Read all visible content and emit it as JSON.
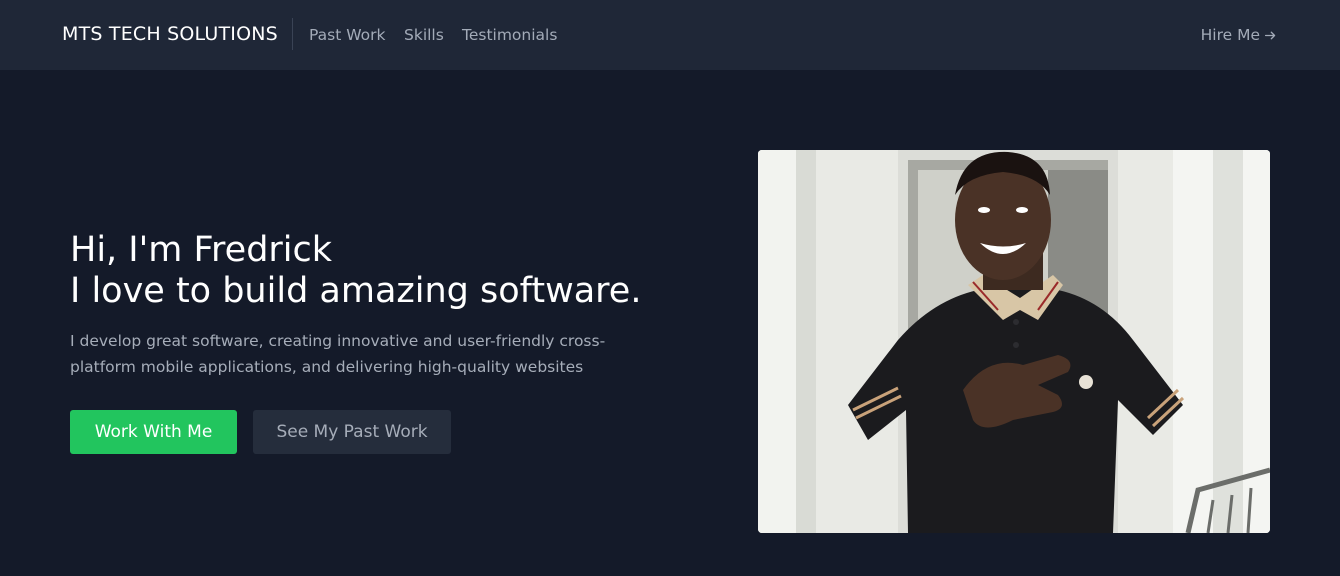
{
  "nav": {
    "brand": "MTS TECH SOLUTIONS",
    "links": [
      "Past Work",
      "Skills",
      "Testimonials"
    ],
    "hire": "Hire Me"
  },
  "hero": {
    "title_line1": "Hi, I'm Fredrick",
    "title_line2": "I love to build amazing software.",
    "subtitle": "I develop great software, creating innovative and user-friendly cross-platform mobile applications, and delivering high-quality websites",
    "primary_button": "Work With Me",
    "secondary_button": "See My Past Work"
  },
  "colors": {
    "background": "#141a29",
    "navbar": "#1f2737",
    "accent": "#22c55e",
    "secondary_button": "#252d3c"
  }
}
